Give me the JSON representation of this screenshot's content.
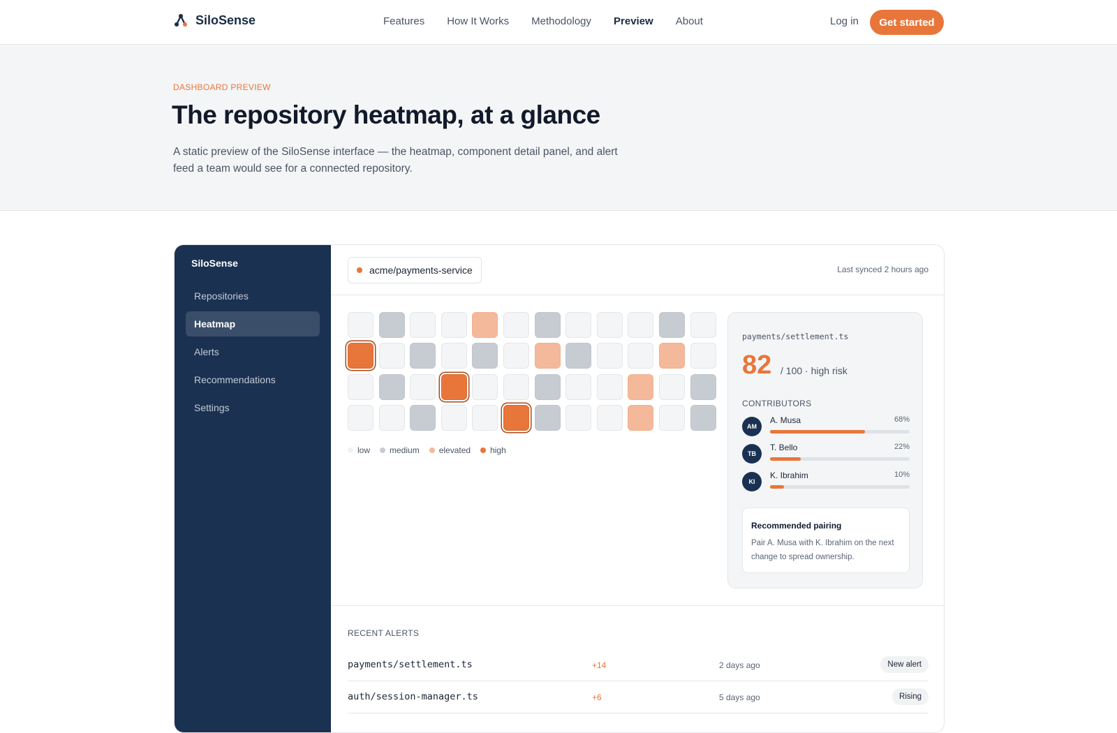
{
  "brand": {
    "name": "SiloSense",
    "icon": "network-nodes-icon"
  },
  "nav": {
    "links": [
      "Features",
      "How It Works",
      "Methodology",
      "Preview",
      "About"
    ],
    "active": "Preview"
  },
  "auth": {
    "login": "Log in",
    "cta": "Get started"
  },
  "hero": {
    "eyebrow": "DASHBOARD PREVIEW",
    "title": "The repository heatmap, at a glance",
    "subtitle": "A static preview of the SiloSense interface — the heatmap, component detail panel, and alert feed a team would see for a connected repository."
  },
  "dashboard": {
    "sidebar": {
      "brand": "SiloSense",
      "items": [
        "Repositories",
        "Heatmap",
        "Alerts",
        "Recommendations",
        "Settings"
      ],
      "active": "Heatmap"
    },
    "repo": {
      "name": "acme/payments-service",
      "synced": "Last synced 2 hours ago"
    },
    "heatmap": {
      "levels": [
        "low",
        "medium",
        "elevated",
        "high"
      ],
      "level_colors": [
        "#f4f5f6",
        "#c7ccd3",
        "#f4b99a",
        "#e8763b"
      ],
      "rows": [
        [
          0,
          1,
          0,
          0,
          2,
          0,
          1,
          0,
          0,
          0,
          1,
          0
        ],
        [
          3,
          0,
          1,
          0,
          1,
          0,
          2,
          1,
          0,
          0,
          2,
          0
        ],
        [
          0,
          1,
          0,
          3,
          0,
          0,
          1,
          0,
          0,
          2,
          0,
          1
        ],
        [
          0,
          0,
          1,
          0,
          0,
          3,
          1,
          0,
          0,
          2,
          0,
          1
        ]
      ],
      "legend": [
        {
          "label": "low",
          "color": "#f0f1f3"
        },
        {
          "label": "medium",
          "color": "#c7ccd3"
        },
        {
          "label": "elevated",
          "color": "#f4b99a"
        },
        {
          "label": "high",
          "color": "#e8763b"
        }
      ]
    },
    "detail": {
      "file": "payments/settlement.ts",
      "score": "82",
      "score_meta": "/ 100 · high risk",
      "contributors_heading": "CONTRIBUTORS",
      "contributors": [
        {
          "initials": "AM",
          "name": "A. Musa",
          "pct": "68%",
          "share": 0.68
        },
        {
          "initials": "TB",
          "name": "T. Bello",
          "pct": "22%",
          "share": 0.22
        },
        {
          "initials": "KI",
          "name": "K. Ibrahim",
          "pct": "10%",
          "share": 0.1
        }
      ],
      "pairing": {
        "title": "Recommended pairing",
        "text": "Pair A. Musa with K. Ibrahim on the next change to spread ownership."
      }
    },
    "alerts": {
      "heading": "RECENT ALERTS",
      "rows": [
        {
          "file": "payments/settlement.ts",
          "delta": "+14",
          "time": "2 days ago",
          "badge": "New alert"
        },
        {
          "file": "auth/session-manager.ts",
          "delta": "+6",
          "time": "5 days ago",
          "badge": "Rising"
        }
      ]
    }
  }
}
